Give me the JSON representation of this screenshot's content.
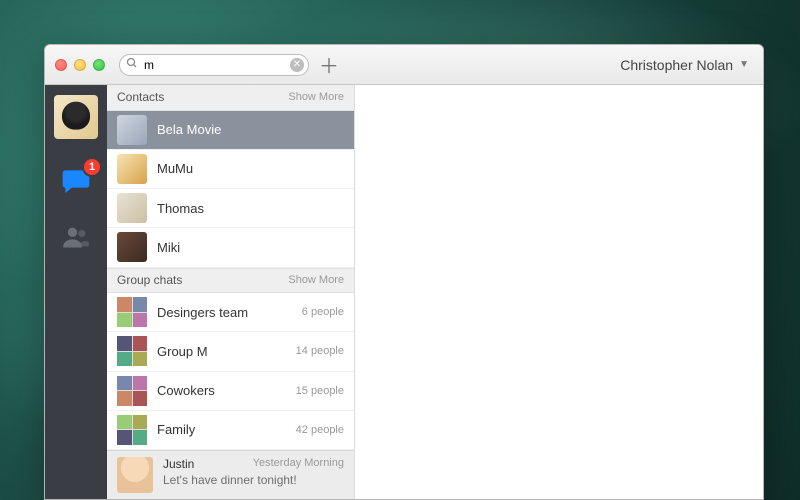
{
  "account": {
    "name": "Christopher Nolan"
  },
  "search": {
    "value": "m"
  },
  "nav": {
    "badge": "1"
  },
  "sections": {
    "contacts": {
      "title": "Contacts",
      "show_more": "Show More"
    },
    "groups": {
      "title": "Group chats",
      "show_more": "Show More"
    }
  },
  "contacts": [
    {
      "name": "Bela Movie",
      "selected": true
    },
    {
      "name": "MuMu"
    },
    {
      "name": "Thomas"
    },
    {
      "name": "Miki"
    }
  ],
  "groups": [
    {
      "name": "Desingers team",
      "meta": "6 people"
    },
    {
      "name": "Group M",
      "meta": "14 people"
    },
    {
      "name": "Cowokers",
      "meta": "15 people"
    },
    {
      "name": "Family",
      "meta": "42 people"
    }
  ],
  "recent": {
    "name": "Justin",
    "time": "Yesterday Morning",
    "message": "Let's have dinner tonight!"
  }
}
